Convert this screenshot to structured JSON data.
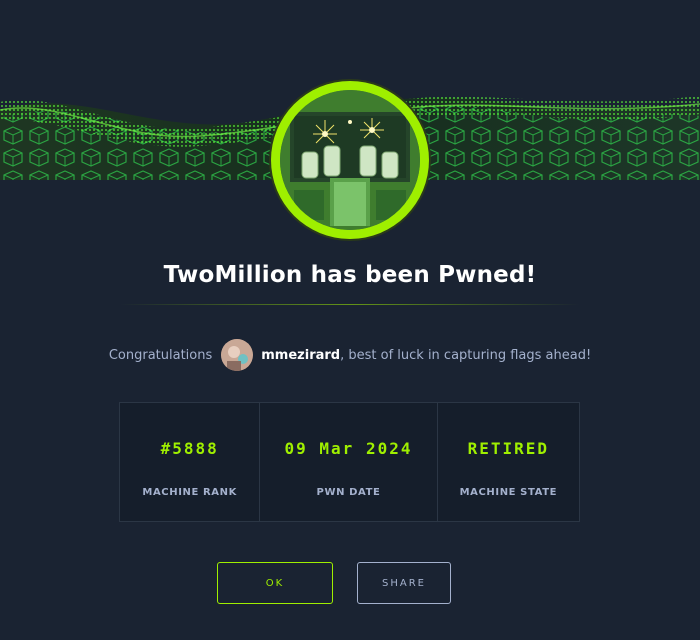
{
  "modal": {
    "title": "TwoMillion has been Pwned!",
    "congrats_prefix": "Congratulations",
    "username": "mmezirard",
    "congrats_suffix": ", best of luck in capturing flags ahead!"
  },
  "stats": [
    {
      "value": "#5888",
      "label": "MACHINE RANK"
    },
    {
      "value": "09 Mar 2024",
      "label": "PWN DATE"
    },
    {
      "value": "RETIRED",
      "label": "MACHINE STATE"
    }
  ],
  "buttons": {
    "ok_label": "OK",
    "share_label": "SHARE"
  },
  "colors": {
    "background": "#1a2332",
    "accent": "#9fef00",
    "muted_text": "#a4b1cd"
  },
  "icons": {
    "machine_avatar": "machine-avatar-icon",
    "user_avatar": "user-avatar-icon"
  }
}
